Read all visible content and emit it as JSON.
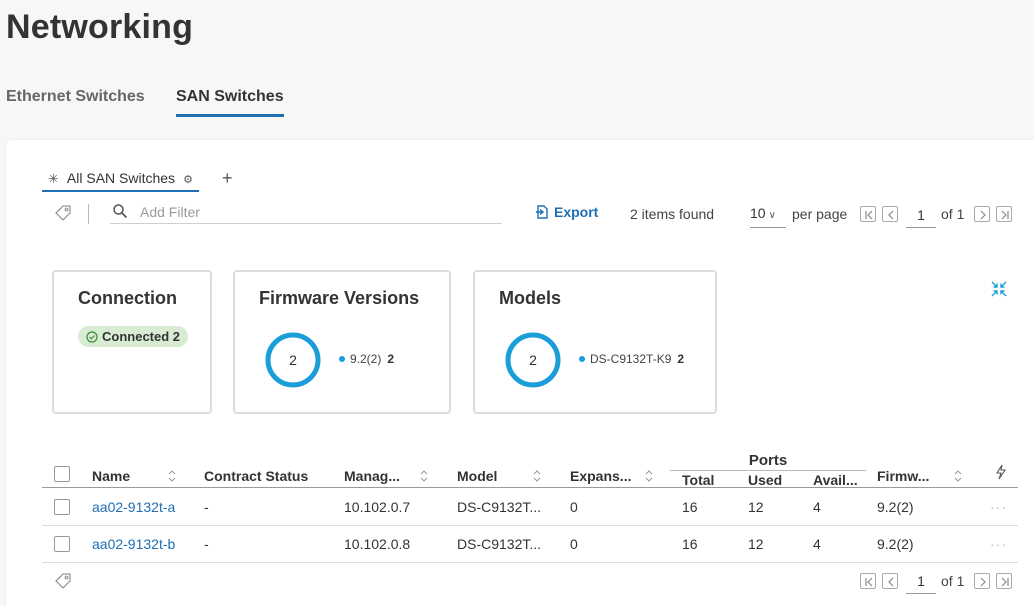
{
  "page_title": "Networking",
  "tabs": [
    {
      "label": "Ethernet Switches",
      "active": false
    },
    {
      "label": "SAN Switches",
      "active": true
    }
  ],
  "view_tab": {
    "label": "All SAN Switches"
  },
  "toolbar": {
    "filter_placeholder": "Add Filter",
    "export_label": "Export",
    "items_found": "2 items found",
    "per_page_value": "10",
    "per_page_label": "per page",
    "page_value": "1",
    "page_of": "of 1"
  },
  "summary": {
    "connection": {
      "title": "Connection",
      "badge": "Connected 2"
    },
    "firmware": {
      "title": "Firmware Versions",
      "total": "2",
      "legend_label": "9.2(2)",
      "legend_count": "2"
    },
    "models": {
      "title": "Models",
      "total": "2",
      "legend_label": "DS-C9132T-K9",
      "legend_count": "2"
    }
  },
  "table": {
    "headers": {
      "name": "Name",
      "contract_status": "Contract Status",
      "management": "Manag...",
      "model": "Model",
      "expansion": "Expans...",
      "ports_group": "Ports",
      "ports_total": "Total",
      "ports_used": "Used",
      "ports_available": "Avail...",
      "firmware": "Firmw..."
    },
    "rows": [
      {
        "name": "aa02-9132t-a",
        "contract_status": "-",
        "management": "10.102.0.7",
        "model": "DS-C9132T...",
        "expansion": "0",
        "total": "16",
        "used": "12",
        "available": "4",
        "firmware": "9.2(2)"
      },
      {
        "name": "aa02-9132t-b",
        "contract_status": "-",
        "management": "10.102.0.8",
        "model": "DS-C9132T...",
        "expansion": "0",
        "total": "16",
        "used": "12",
        "available": "4",
        "firmware": "9.2(2)"
      }
    ]
  },
  "footer": {
    "page_value": "1",
    "page_of": "of 1"
  },
  "colors": {
    "accent": "#1e6fb4",
    "donut": "#1a9ed8",
    "badge_bg": "#d8ecd4"
  }
}
